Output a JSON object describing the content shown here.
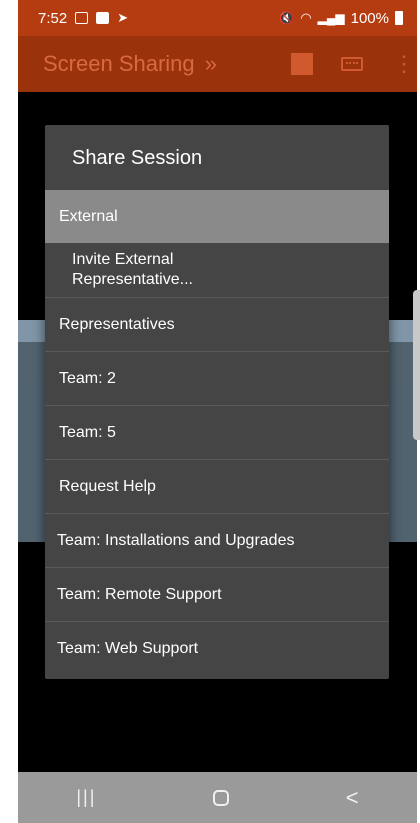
{
  "status_bar": {
    "time": "7:52",
    "battery": "100%"
  },
  "app_bar": {
    "title": "Screen Sharing",
    "chevron": "»"
  },
  "dialog": {
    "title": "Share Session",
    "items": [
      {
        "label": "External"
      },
      {
        "label": "Invite External\nRepresentative..."
      },
      {
        "label": "Representatives"
      },
      {
        "label": "Team: 2"
      },
      {
        "label": "Team: 5"
      },
      {
        "label": "Request Help"
      },
      {
        "label": "Team: Installations and Upgrades"
      },
      {
        "label": "Team: Remote Support"
      },
      {
        "label": "Team: Web Support"
      }
    ]
  },
  "nav_bar": {
    "recent_glyph": "|||",
    "back_glyph": "<"
  },
  "colors": {
    "status_bar": "#b53c10",
    "app_bar": "#9a320c",
    "dialog_bg": "#454545",
    "section_header": "#8a8a8a",
    "nav_bar": "#9a9a9a"
  }
}
